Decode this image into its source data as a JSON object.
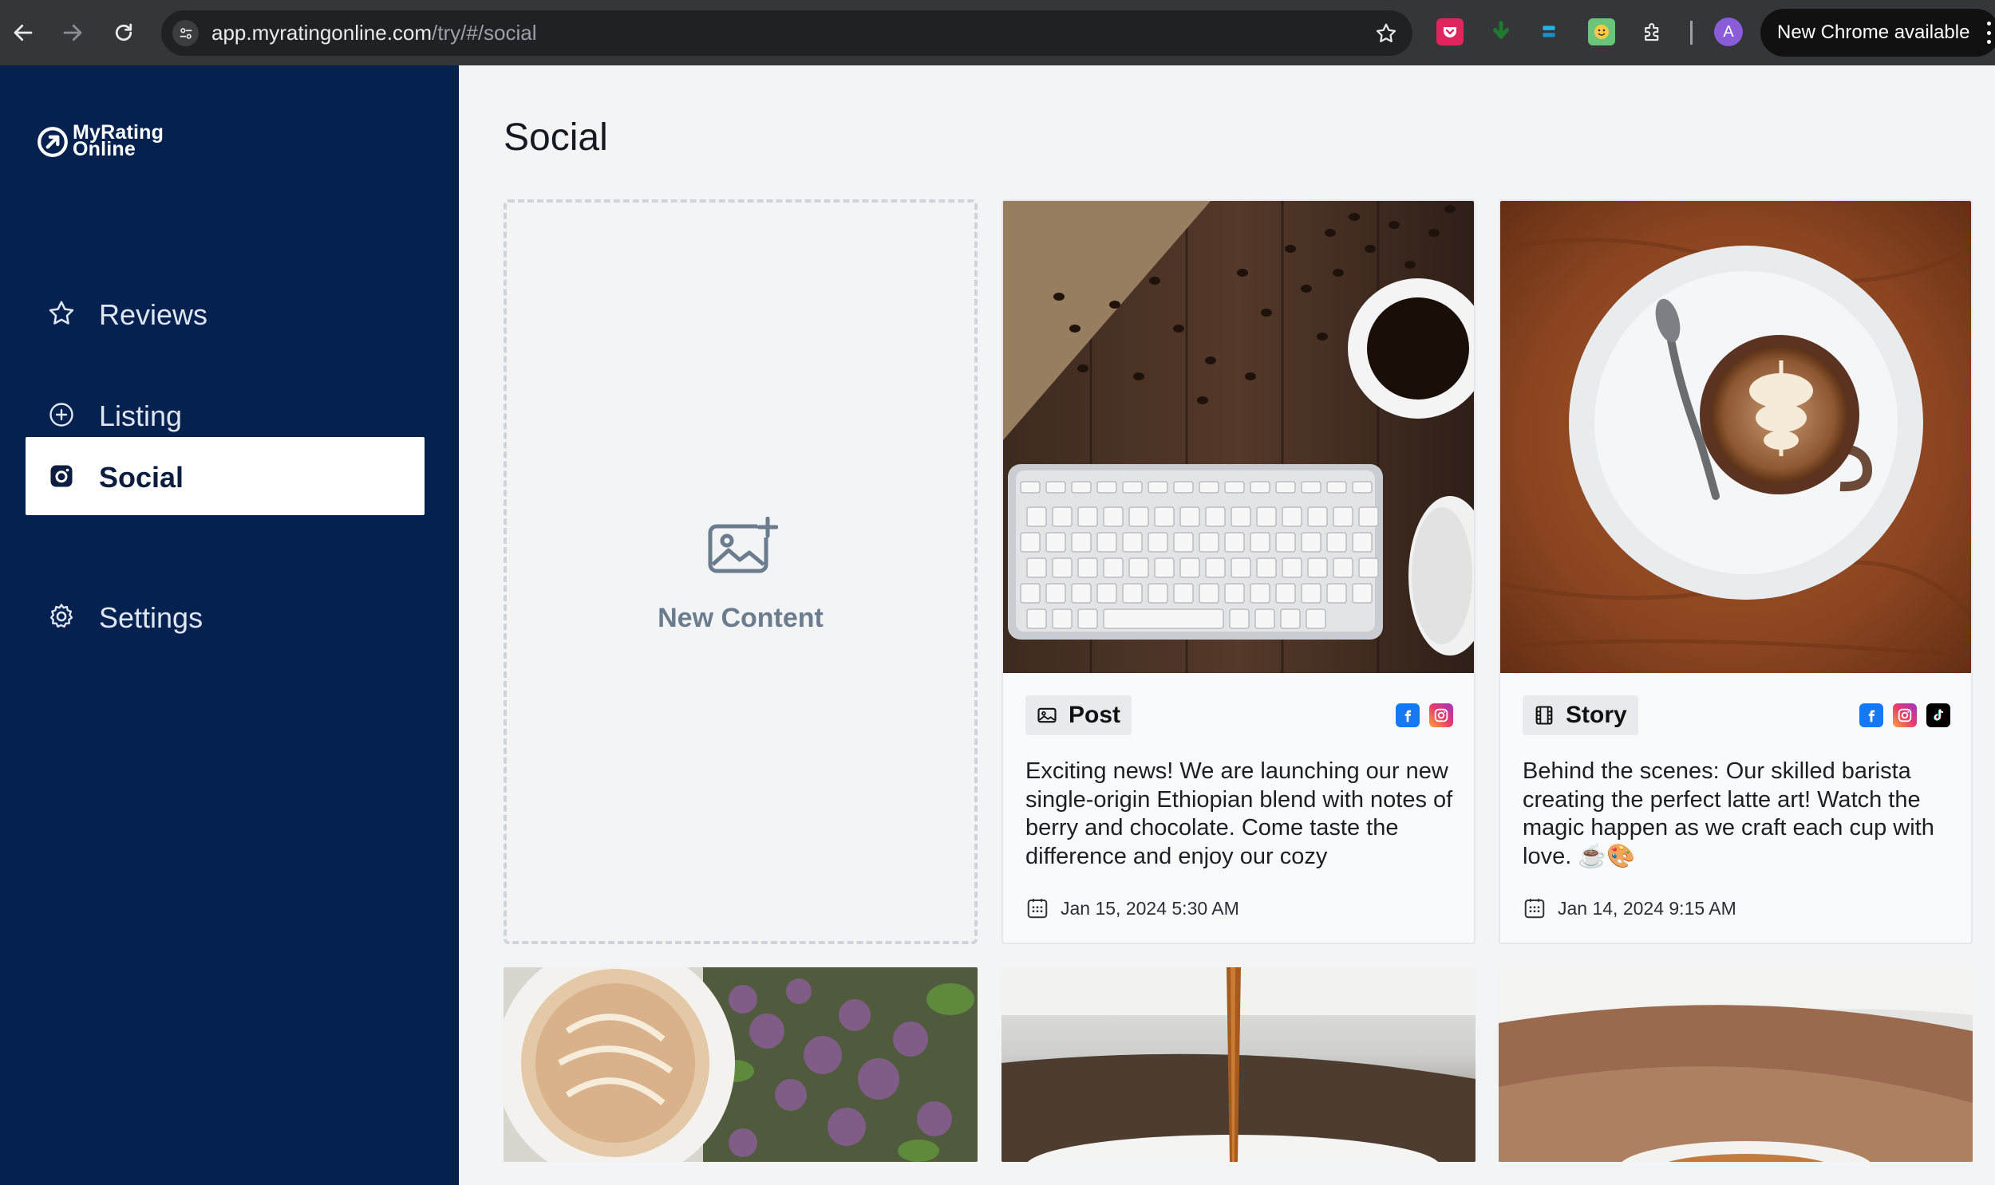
{
  "browser": {
    "url_host": "app.myratingonline.com",
    "url_path": "/try/#/social",
    "profile_initial": "A",
    "update_label": "New Chrome available"
  },
  "sidebar": {
    "logo": "MyRating Online",
    "items": [
      {
        "label": "Reviews",
        "icon": "star-icon",
        "active": false
      },
      {
        "label": "Listing",
        "icon": "location-plus-icon",
        "active": false
      },
      {
        "label": "Social",
        "icon": "instagram-icon",
        "active": true
      },
      {
        "label": "Settings",
        "icon": "gear-icon",
        "active": false
      }
    ]
  },
  "main": {
    "title": "Social",
    "new_content_label": "New Content",
    "posts": [
      {
        "type": "Post",
        "type_icon": "image-icon",
        "networks": [
          "facebook",
          "instagram"
        ],
        "caption": "Exciting news! We are launching our new single-origin Ethiopian blend with notes of berry and chocolate. Come taste the difference and enjoy our cozy",
        "date": "Jan 15, 2024 5:30 AM",
        "image": "coffee-beans-keyboard-mouse"
      },
      {
        "type": "Story",
        "type_icon": "film-icon",
        "networks": [
          "facebook",
          "instagram",
          "tiktok"
        ],
        "caption": "Behind the scenes: Our skilled barista creating the perfect latte art! Watch the magic happen as we craft each cup with love. ☕🎨",
        "date": "Jan 14, 2024 9:15 AM",
        "image": "latte-art-on-wood"
      }
    ],
    "thumbnails": [
      "latte-with-lilacs",
      "coffee-pour",
      "coffee-cup-table"
    ]
  },
  "colors": {
    "sidebar_bg": "#04214f",
    "main_bg": "#f3f4f6",
    "chrome_bg": "#35363a",
    "facebook": "#1877f2",
    "tiktok": "#000000"
  }
}
